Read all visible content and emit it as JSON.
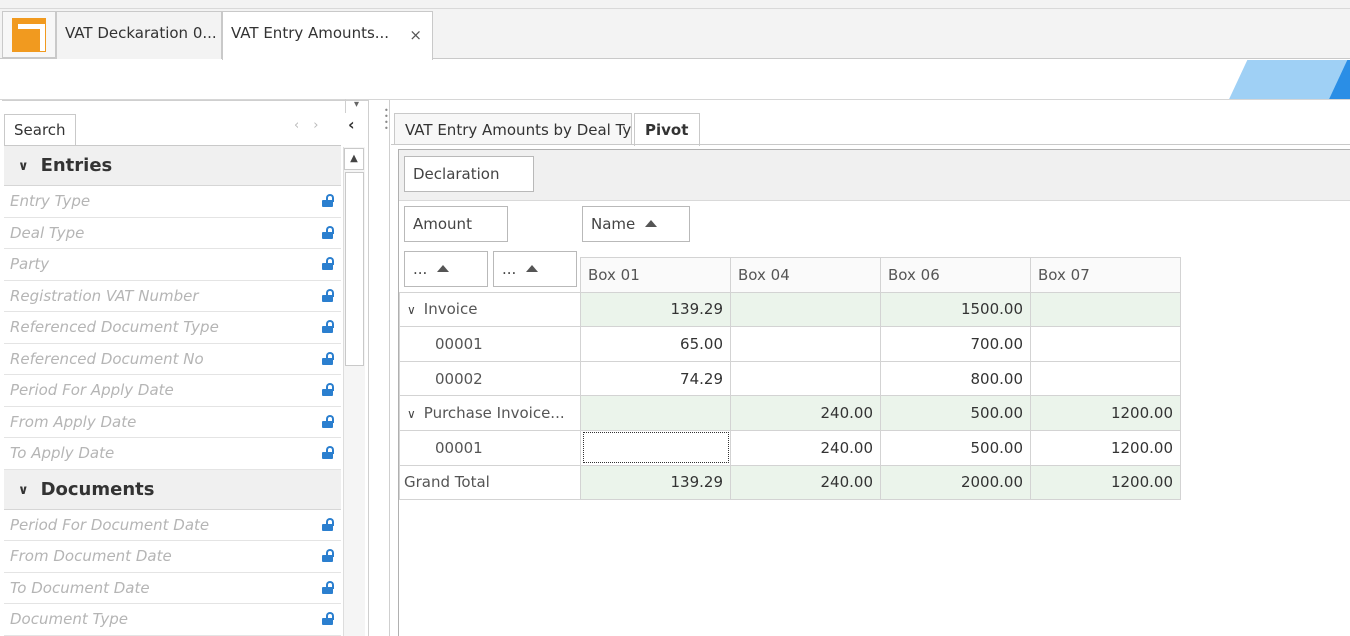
{
  "tabs": {
    "tab1_label": "VAT Deckaration 0...",
    "tab2_label": "VAT Entry Amounts...",
    "close_glyph": "×"
  },
  "left": {
    "search_tab": "Search",
    "groups": [
      {
        "title": "Entries",
        "fields": [
          "Entry Type",
          "Deal Type",
          "Party",
          "Registration VAT Number",
          "Referenced Document Type",
          "Referenced Document No",
          "Period For Apply Date",
          "From Apply Date",
          "To Apply Date"
        ]
      },
      {
        "title": "Documents",
        "fields": [
          "Period For Document Date",
          "From Document Date",
          "To Document Date",
          "Document Type"
        ]
      }
    ]
  },
  "right": {
    "tab1_label": "VAT Entry Amounts by Deal Type",
    "tab2_label": "Pivot",
    "filter_field": "Declaration",
    "data_field": "Amount",
    "column_field": "Name",
    "row_field1": "...",
    "row_field2": "...",
    "columns": [
      "Box 01",
      "Box 04",
      "Box 06",
      "Box 07"
    ],
    "rows": [
      {
        "label": "Invoice",
        "level": 0,
        "values": [
          "139.29",
          "",
          "1500.00",
          ""
        ]
      },
      {
        "label": "00001",
        "level": 1,
        "values": [
          "65.00",
          "",
          "700.00",
          ""
        ]
      },
      {
        "label": "00002",
        "level": 1,
        "values": [
          "74.29",
          "",
          "800.00",
          ""
        ]
      },
      {
        "label": "Purchase Invoice...",
        "level": 0,
        "values": [
          "",
          "240.00",
          "500.00",
          "1200.00"
        ]
      },
      {
        "label": "00001",
        "level": 1,
        "values": [
          "",
          "240.00",
          "500.00",
          "1200.00"
        ]
      }
    ],
    "grand_total": {
      "label": "Grand Total",
      "values": [
        "139.29",
        "240.00",
        "2000.00",
        "1200.00"
      ]
    }
  },
  "icons": {
    "app_logo": "app-logo-icon",
    "lock": "unlock-icon",
    "expand": "chevron-down-icon",
    "sort": "sort-ascending-icon"
  },
  "colors": {
    "accent": "#2a8ee6",
    "logo": "#f19a1f",
    "total_row": "#ebf4eb"
  }
}
